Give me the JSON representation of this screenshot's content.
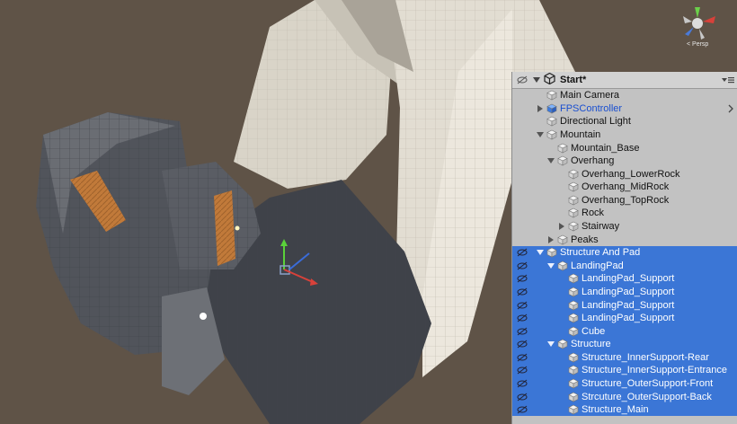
{
  "viewport": {
    "projection_label": "< Persp",
    "colors": {
      "background": "#5f5347",
      "rock_light": "#ddd8cd",
      "rock_shadow": "#4e5158",
      "wood": "#c17a3a"
    }
  },
  "hierarchy": {
    "scene_name": "Start*",
    "colors": {
      "panel": "#c2c2c2",
      "selection": "#3b76d6",
      "prefab_text": "#1a4fd0"
    },
    "rows": [
      {
        "label": "Main Camera",
        "depth": 0,
        "fold": "none",
        "selected": false,
        "prefab": false
      },
      {
        "label": "FPSController",
        "depth": 0,
        "fold": "collapsed",
        "selected": false,
        "prefab": true
      },
      {
        "label": "Directional Light",
        "depth": 0,
        "fold": "none",
        "selected": false,
        "prefab": false
      },
      {
        "label": "Mountain",
        "depth": 0,
        "fold": "expanded",
        "selected": false,
        "prefab": false
      },
      {
        "label": "Mountain_Base",
        "depth": 1,
        "fold": "none",
        "selected": false,
        "prefab": false
      },
      {
        "label": "Overhang",
        "depth": 1,
        "fold": "expanded",
        "selected": false,
        "prefab": false
      },
      {
        "label": "Overhang_LowerRock",
        "depth": 2,
        "fold": "none",
        "selected": false,
        "prefab": false
      },
      {
        "label": "Overhang_MidRock",
        "depth": 2,
        "fold": "none",
        "selected": false,
        "prefab": false
      },
      {
        "label": "Overhang_TopRock",
        "depth": 2,
        "fold": "none",
        "selected": false,
        "prefab": false
      },
      {
        "label": "Rock",
        "depth": 2,
        "fold": "none",
        "selected": false,
        "prefab": false
      },
      {
        "label": "Stairway",
        "depth": 2,
        "fold": "collapsed",
        "selected": false,
        "prefab": false
      },
      {
        "label": "Peaks",
        "depth": 1,
        "fold": "collapsed",
        "selected": false,
        "prefab": false
      },
      {
        "label": "Structure And Pad",
        "depth": 0,
        "fold": "expanded",
        "selected": true,
        "prefab": false
      },
      {
        "label": "LandingPad",
        "depth": 1,
        "fold": "expanded",
        "selected": true,
        "prefab": false
      },
      {
        "label": "LandingPad_Support",
        "depth": 2,
        "fold": "none",
        "selected": true,
        "prefab": false
      },
      {
        "label": "LandingPad_Support",
        "depth": 2,
        "fold": "none",
        "selected": true,
        "prefab": false
      },
      {
        "label": "LandingPad_Support",
        "depth": 2,
        "fold": "none",
        "selected": true,
        "prefab": false
      },
      {
        "label": "LandingPad_Support",
        "depth": 2,
        "fold": "none",
        "selected": true,
        "prefab": false
      },
      {
        "label": "Cube",
        "depth": 2,
        "fold": "none",
        "selected": true,
        "prefab": false
      },
      {
        "label": "Structure",
        "depth": 1,
        "fold": "expanded",
        "selected": true,
        "prefab": false
      },
      {
        "label": "Structure_InnerSupport-Rear",
        "depth": 2,
        "fold": "none",
        "selected": true,
        "prefab": false
      },
      {
        "label": "Structure_InnerSupport-Entrance",
        "depth": 2,
        "fold": "none",
        "selected": true,
        "prefab": false
      },
      {
        "label": "Structure_OuterSupport-Front",
        "depth": 2,
        "fold": "none",
        "selected": true,
        "prefab": false
      },
      {
        "label": "Strcuture_OuterSupport-Back",
        "depth": 2,
        "fold": "none",
        "selected": true,
        "prefab": false
      },
      {
        "label": "Structure_Main",
        "depth": 2,
        "fold": "none",
        "selected": true,
        "prefab": false
      }
    ]
  }
}
